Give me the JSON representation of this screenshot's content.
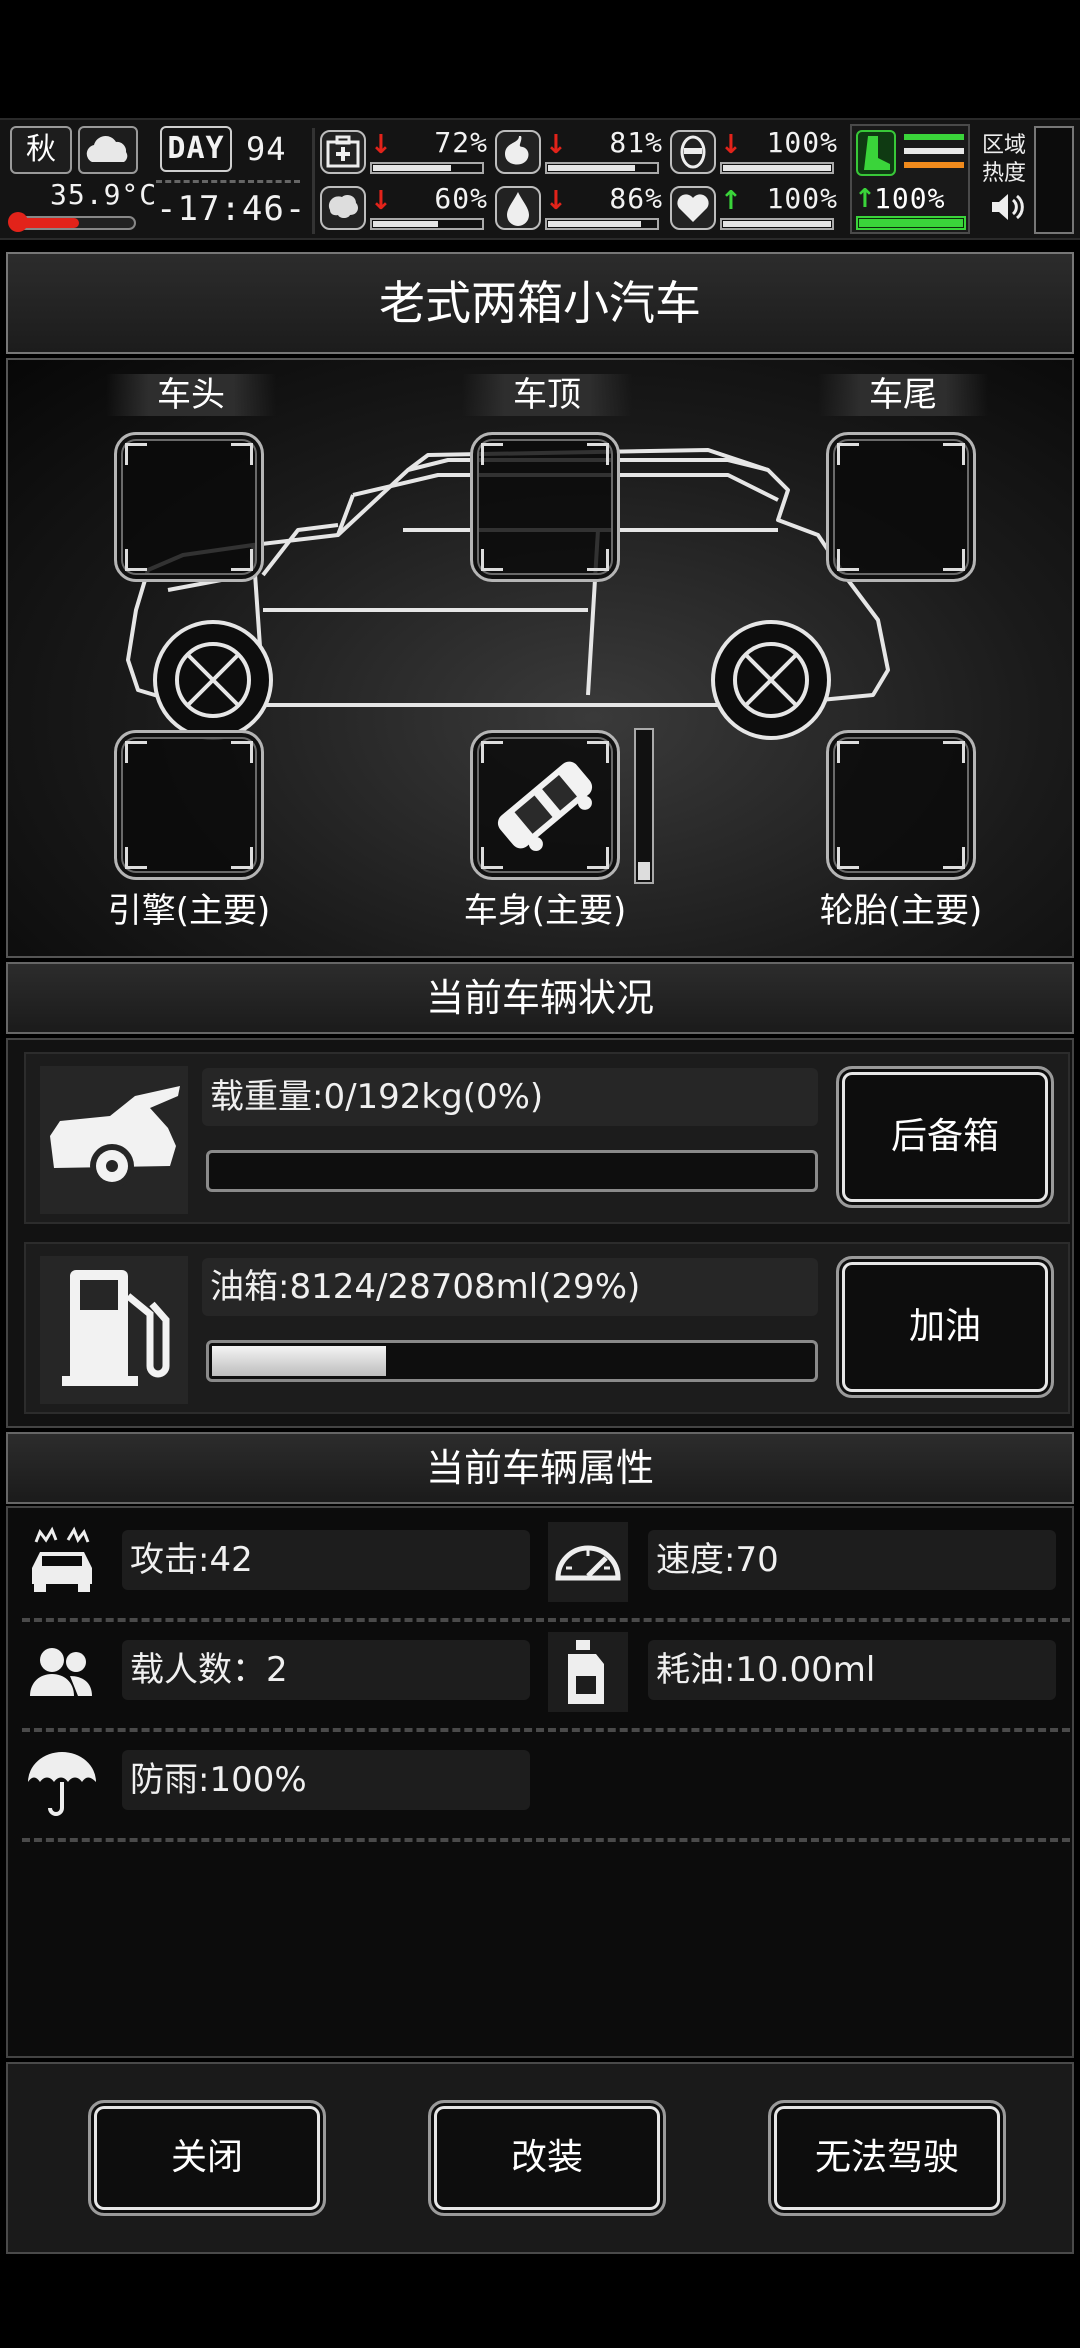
{
  "hud": {
    "season": "秋",
    "temperature": "35.9°C",
    "thermometer_level": 0.55,
    "day_label": "DAY",
    "day_number": "94",
    "clock": "-17:46-",
    "stats_top": [
      {
        "icon": "medkit-icon",
        "trend": "down",
        "percent": "72%",
        "level": 0.72
      },
      {
        "icon": "stomach-icon",
        "trend": "down",
        "percent": "81%",
        "level": 0.81
      },
      {
        "icon": "toilet-icon",
        "trend": "down",
        "percent": "100%",
        "level": 1.0
      }
    ],
    "stats_bottom": [
      {
        "icon": "brain-icon",
        "trend": "down",
        "percent": "60%",
        "level": 0.6
      },
      {
        "icon": "water-drop-icon",
        "trend": "down",
        "percent": "86%",
        "level": 0.86
      },
      {
        "icon": "heart-icon",
        "trend": "up",
        "percent": "100%",
        "level": 1.0
      }
    ],
    "stamina": {
      "percent": "100%",
      "level": 1.0,
      "accent": "#3ad43a"
    },
    "zone_label": "区域热度"
  },
  "vehicle": {
    "name": "老式两箱小汽车",
    "slots_top": [
      "车头",
      "车顶",
      "车尾"
    ],
    "slots_bottom": [
      "引擎(主要)",
      "车身(主要)",
      "轮胎(主要)"
    ],
    "body_durability_level": 0.12
  },
  "status": {
    "header": "当前车辆状况",
    "load": {
      "text": "载重量:0/192kg(0%)",
      "level": 0.0,
      "button": "后备箱"
    },
    "fuel": {
      "text": "油箱:8124/28708ml(29%)",
      "level": 0.29,
      "button": "加油"
    }
  },
  "attributes": {
    "header": "当前车辆属性",
    "items": [
      {
        "icon": "car-attack-icon",
        "text": "攻击:42"
      },
      {
        "icon": "speedometer-icon",
        "text": "速度:70"
      },
      {
        "icon": "passengers-icon",
        "text": "载人数：2"
      },
      {
        "icon": "oil-can-icon",
        "text": "耗油:10.00ml"
      },
      {
        "icon": "umbrella-icon",
        "text": "防雨:100%"
      }
    ]
  },
  "footer": {
    "close": "关闭",
    "modify": "改装",
    "drive": "无法驾驶"
  }
}
